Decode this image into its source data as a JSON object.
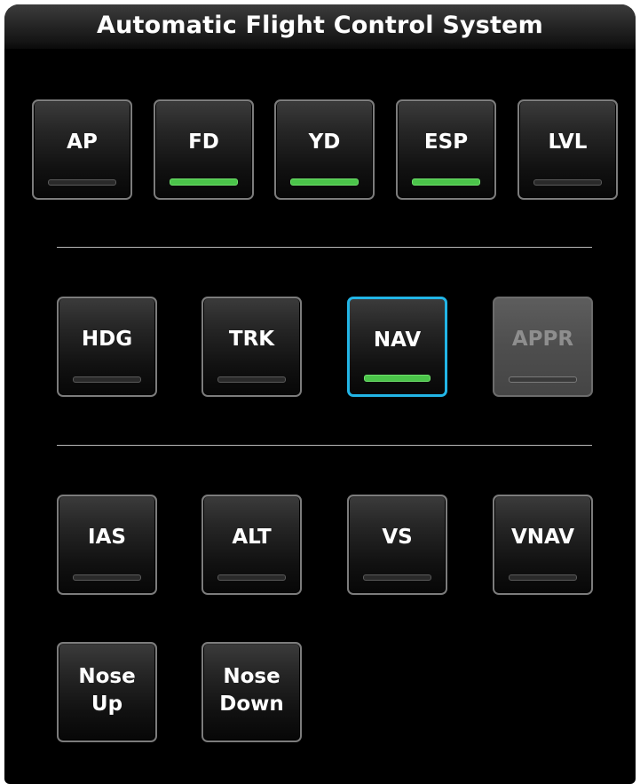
{
  "title": "Automatic Flight Control System",
  "rows": [
    {
      "buttons": [
        {
          "label": "AP",
          "indicator": "off",
          "state": "normal"
        },
        {
          "label": "FD",
          "indicator": "on",
          "state": "normal"
        },
        {
          "label": "YD",
          "indicator": "on",
          "state": "normal"
        },
        {
          "label": "ESP",
          "indicator": "on",
          "state": "normal"
        },
        {
          "label": "LVL",
          "indicator": "off",
          "state": "normal"
        }
      ]
    },
    {
      "buttons": [
        {
          "label": "HDG",
          "indicator": "off",
          "state": "normal"
        },
        {
          "label": "TRK",
          "indicator": "off",
          "state": "normal"
        },
        {
          "label": "NAV",
          "indicator": "on",
          "state": "selected"
        },
        {
          "label": "APPR",
          "indicator": "off",
          "state": "disabled"
        }
      ]
    },
    {
      "buttons": [
        {
          "label": "IAS",
          "indicator": "off",
          "state": "normal"
        },
        {
          "label": "ALT",
          "indicator": "off",
          "state": "normal"
        },
        {
          "label": "VS",
          "indicator": "off",
          "state": "normal"
        },
        {
          "label": "VNAV",
          "indicator": "off",
          "state": "normal"
        }
      ]
    },
    {
      "buttons": [
        {
          "label": "Nose\nUp"
        },
        {
          "label": "Nose\nDown"
        }
      ]
    }
  ],
  "colors": {
    "indicator_on": "#4bc44a",
    "selected_border": "#22b5e6",
    "panel_background": "#000000"
  }
}
